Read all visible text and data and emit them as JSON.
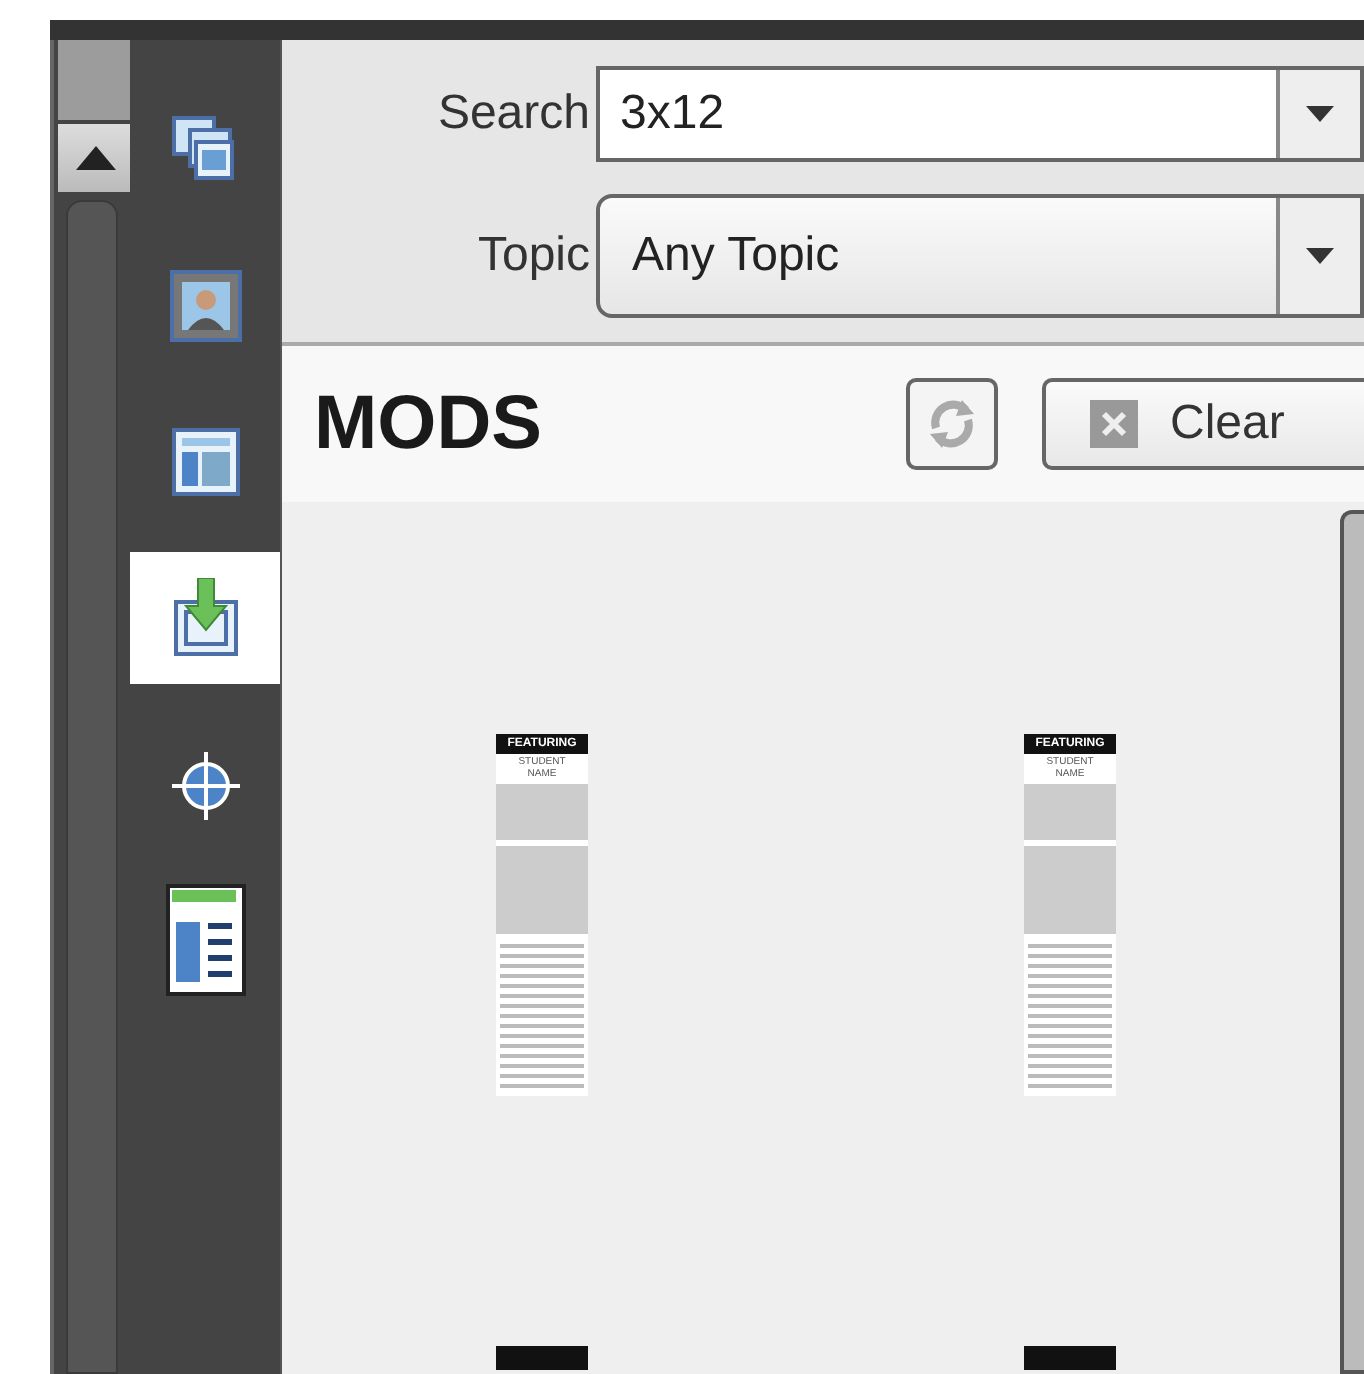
{
  "sidebar": {
    "items": [
      {
        "kind": "gallery",
        "selected": false
      },
      {
        "kind": "portrait",
        "selected": false
      },
      {
        "kind": "layout",
        "selected": false
      },
      {
        "kind": "import",
        "selected": true
      },
      {
        "kind": "target",
        "selected": false
      },
      {
        "kind": "page",
        "selected": false
      }
    ]
  },
  "search": {
    "label": "Search",
    "value": "3x12"
  },
  "topic": {
    "label": "Topic",
    "value": "Any Topic"
  },
  "panel": {
    "title": "MODS",
    "clear_button": "Clear"
  },
  "mods": [
    {
      "header": "FEATURING",
      "subtitle": "STUDENT NAME",
      "cut": false
    },
    {
      "header": "FEATURING",
      "subtitle": "STUDENT NAME",
      "cut": false
    },
    {
      "cut": true
    },
    {
      "cut": true
    }
  ]
}
